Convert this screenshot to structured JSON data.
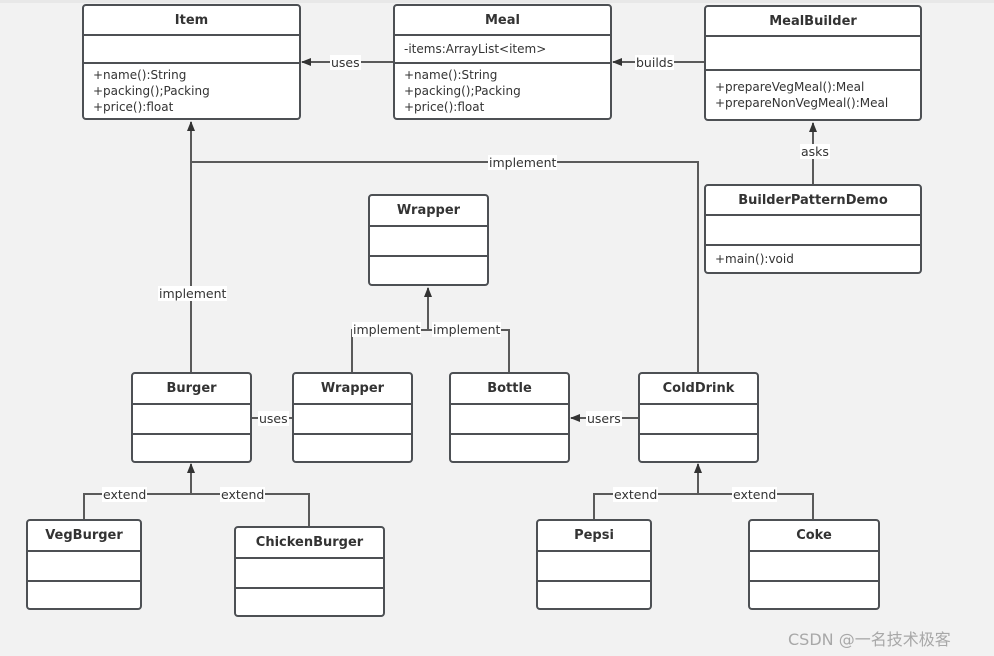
{
  "classes": {
    "item": {
      "name": "Item",
      "attributes": "",
      "operations": [
        "+name():String",
        "+packing();Packing",
        "+price():float"
      ]
    },
    "meal": {
      "name": "Meal",
      "attributes": "-items:ArrayList<item>",
      "operations": [
        "+name():String",
        "+packing();Packing",
        "+price():float"
      ]
    },
    "meal_builder": {
      "name": "MealBuilder",
      "attributes": "",
      "operations": [
        "+prepareVegMeal():Meal",
        "+prepareNonVegMeal():Meal"
      ]
    },
    "builder_pattern_demo": {
      "name": "BuilderPatternDemo",
      "attributes": "",
      "operations": [
        "+main():void"
      ]
    },
    "wrapper_interface": {
      "name": "Wrapper"
    },
    "burger": {
      "name": "Burger"
    },
    "wrapper": {
      "name": "Wrapper"
    },
    "bottle": {
      "name": "Bottle"
    },
    "cold_drink": {
      "name": "ColdDrink"
    },
    "veg_burger": {
      "name": "VegBurger"
    },
    "chicken_burger": {
      "name": "ChickenBurger"
    },
    "pepsi": {
      "name": "Pepsi"
    },
    "coke": {
      "name": "Coke"
    }
  },
  "relations": {
    "meal_uses_item": "uses",
    "builder_builds_meal": "builds",
    "demo_asks_builder": "asks",
    "colddrink_implements_item": "implement",
    "burger_implements_item": "implement",
    "wrapper_implements_wrapper": "implement",
    "bottle_implements_wrapper": "implement",
    "burger_uses_wrapper": "uses",
    "colddrink_users_bottle": "users",
    "vegburger_extends_burger": "extend",
    "chickenburger_extends_burger": "extend",
    "pepsi_extends_colddrink": "extend",
    "coke_extends_colddrink": "extend"
  },
  "watermark": "CSDN @一名技术极客"
}
